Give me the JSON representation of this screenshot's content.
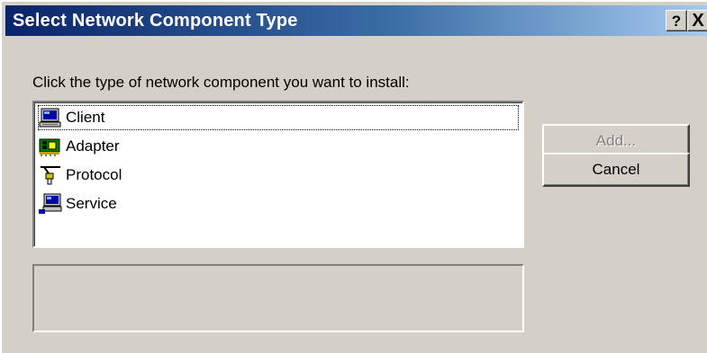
{
  "window": {
    "title": "Select Network Component Type",
    "help_button": "?",
    "close_button": "X"
  },
  "instruction": "Click the type of network component you want to install:",
  "components": [
    {
      "label": "Client",
      "icon": "client-icon",
      "selected": true
    },
    {
      "label": "Adapter",
      "icon": "adapter-icon",
      "selected": false
    },
    {
      "label": "Protocol",
      "icon": "protocol-icon",
      "selected": false
    },
    {
      "label": "Service",
      "icon": "service-icon",
      "selected": false
    }
  ],
  "description": "",
  "buttons": {
    "add_label": "Add...",
    "add_enabled": false,
    "cancel_label": "Cancel"
  },
  "colors": {
    "face": "#d4d0c8",
    "title_start": "#0a246a",
    "title_end": "#a6caf0",
    "list_bg": "#ffffff",
    "disabled_text": "#808080"
  }
}
